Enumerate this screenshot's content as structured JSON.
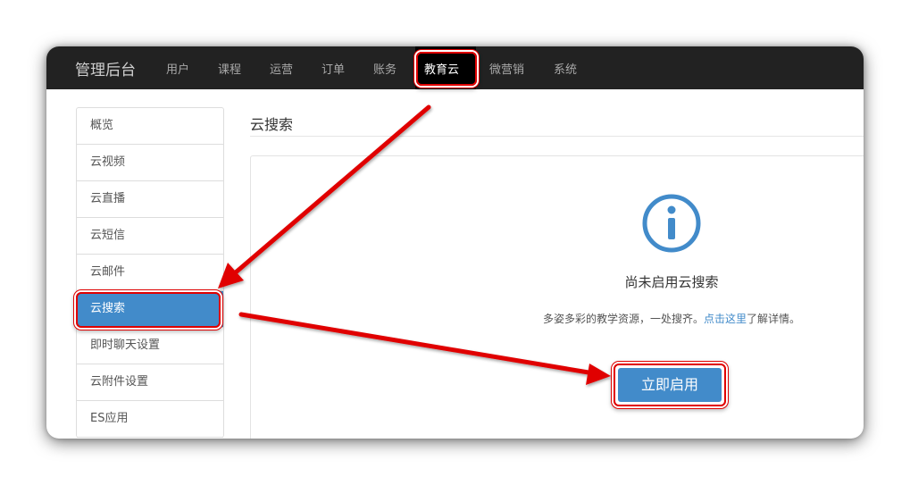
{
  "app": {
    "brand": "管理后台"
  },
  "topnav": {
    "items": [
      "用户",
      "课程",
      "运营",
      "订单",
      "账务",
      "教育云",
      "微营销",
      "系统"
    ],
    "active": "教育云"
  },
  "sidebar": {
    "items": [
      "概览",
      "云视频",
      "云直播",
      "云短信",
      "云邮件",
      "云搜索",
      "即时聊天设置",
      "云附件设置",
      "ES应用"
    ],
    "active": "云搜索"
  },
  "main": {
    "title": "云搜索",
    "empty_state": {
      "icon": "info-circle-icon",
      "heading": "尚未启用云搜索",
      "desc_prefix": "多姿多彩的教学资源，一处搜齐。",
      "desc_link": "点击这里",
      "desc_suffix": "了解详情。",
      "button_label": "立即启用"
    }
  },
  "annotation": {
    "color": "#e00000"
  },
  "colors": {
    "topbar": "#222222",
    "accent": "#428bca",
    "active_nav": "#000000"
  }
}
